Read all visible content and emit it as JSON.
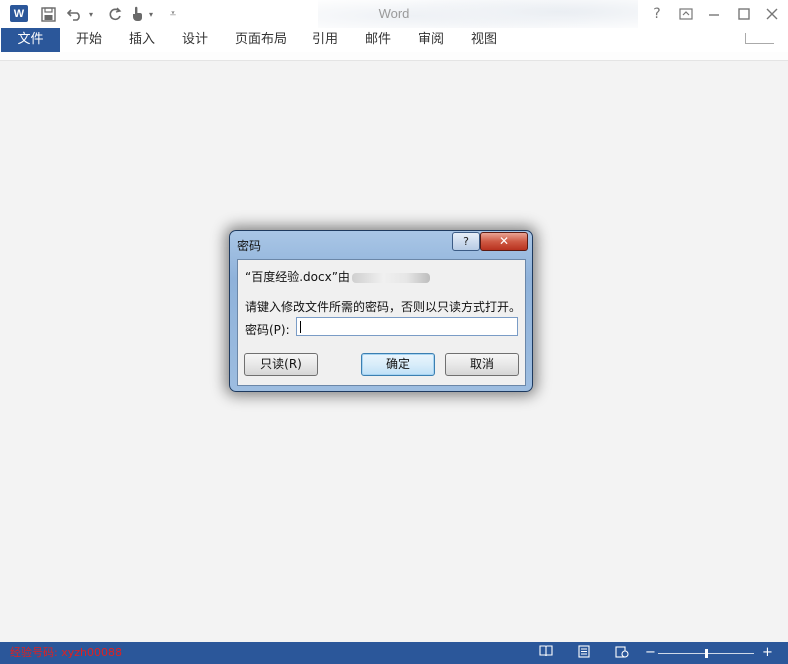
{
  "app": {
    "title": "Word"
  },
  "quick_access": {
    "logo_letter": "W",
    "save_icon": "save-icon",
    "undo_icon": "undo-icon",
    "redo_icon": "redo-icon",
    "touch_icon": "touch-mode-icon",
    "customize_icon": "customize-qat-icon"
  },
  "window_controls": {
    "help": "?",
    "ribbon_display": "⊡",
    "minimize": "—",
    "maximize": "□",
    "close": "✕"
  },
  "ribbon": {
    "file_tab": "文件",
    "tabs": [
      "开始",
      "插入",
      "设计",
      "页面布局",
      "引用",
      "邮件",
      "审阅",
      "视图"
    ]
  },
  "dialog": {
    "title": "密码",
    "help_label": "?",
    "close_label": "✕",
    "file_line_prefix": "“百度经验.docx”由",
    "instruction": "请键入修改文件所需的密码，否则以只读方式打开。",
    "password_label": "密码(P):",
    "password_value": "",
    "buttons": {
      "readonly": "只读(R)",
      "ok": "确定",
      "cancel": "取消"
    }
  },
  "status_bar": {
    "watermark": "经验号码: xyzh00088",
    "read_mode_icon": "read-mode-icon",
    "print_layout_icon": "print-layout-icon",
    "web_layout_icon": "web-layout-icon",
    "zoom_minus": "−",
    "zoom_plus": "+",
    "colors": {
      "bar": "#2b579a",
      "watermark": "#e02020"
    }
  }
}
